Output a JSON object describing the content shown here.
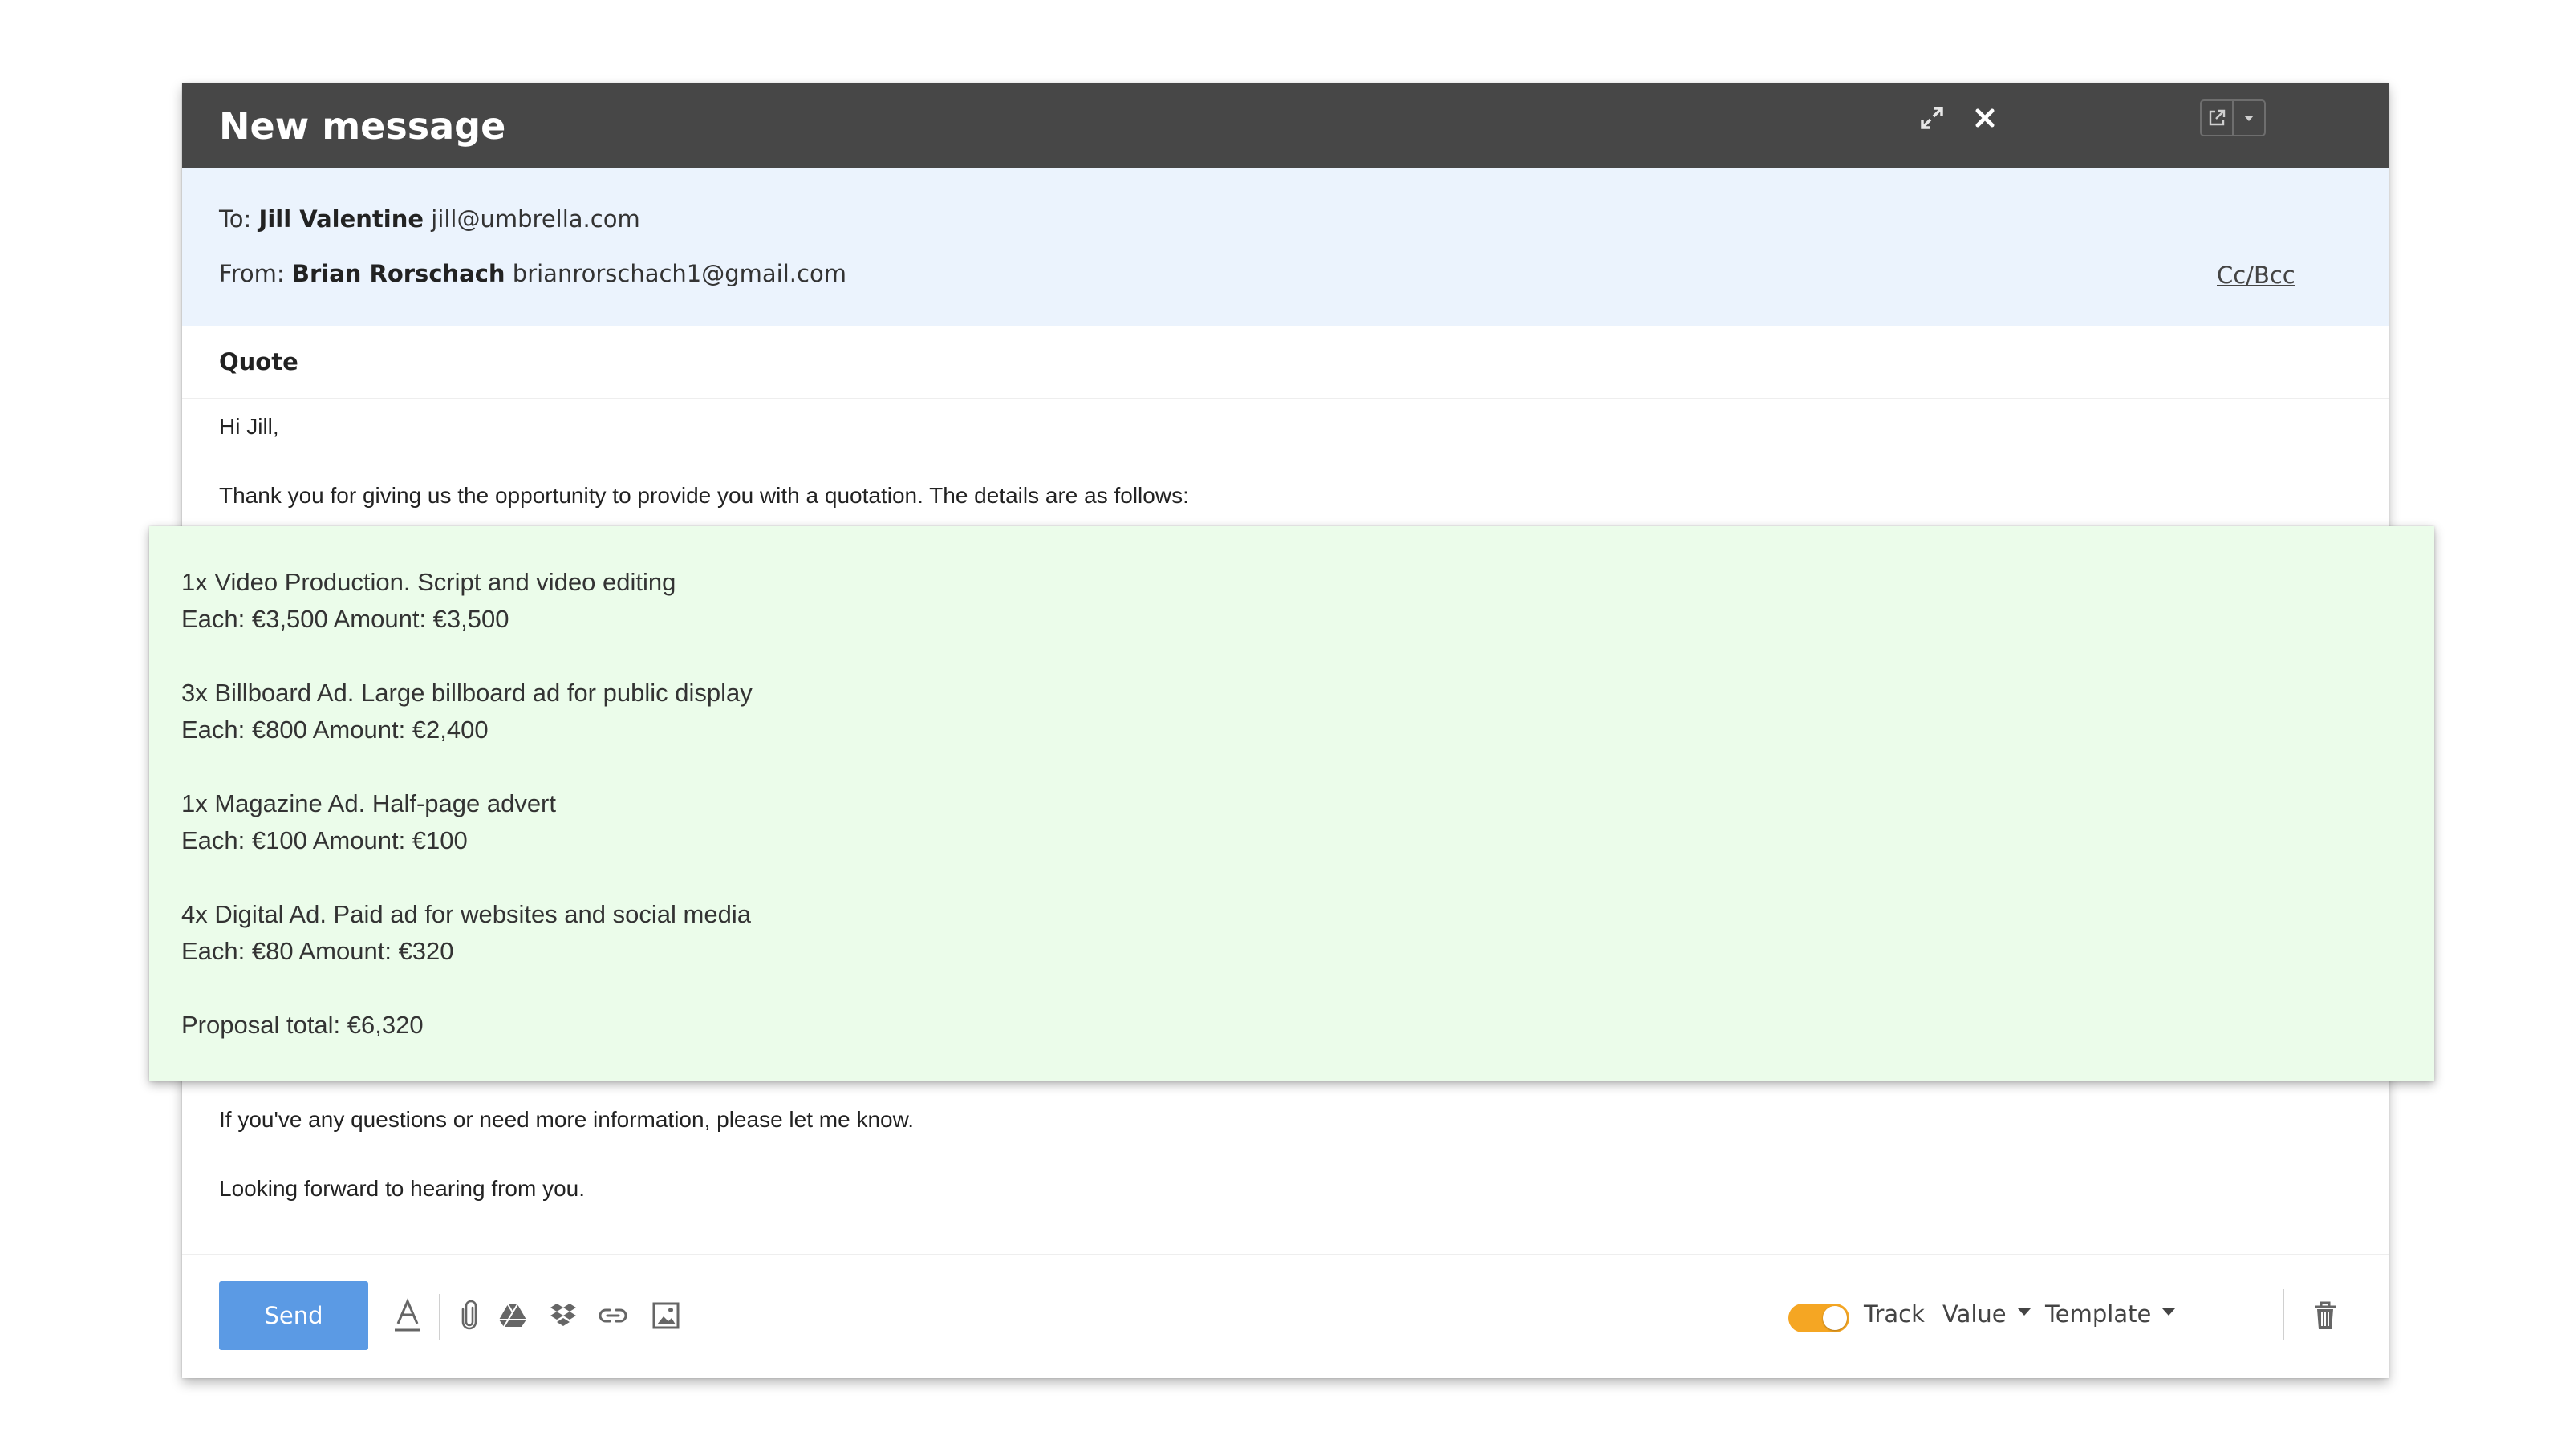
{
  "window": {
    "title": "New message"
  },
  "headers": {
    "to_label": "To:",
    "to_name": "Jill Valentine",
    "to_email": "jill@umbrella.com",
    "from_label": "From:",
    "from_name": "Brian Rorschach",
    "from_email": "brianrorschach1@gmail.com",
    "ccbcc": "Cc/Bcc"
  },
  "subject": "Quote",
  "body": {
    "greeting": "Hi Jill,",
    "intro": "Thank you for giving us the opportunity to provide you with a quotation. The details are as follows:",
    "closing1": "If you've any questions or need more information, please let me know.",
    "closing2": "Looking forward to hearing from you."
  },
  "quote": {
    "items": [
      {
        "title": "1x Video Production. Script and video editing",
        "price": "Each: €3,500  Amount: €3,500"
      },
      {
        "title": "3x Billboard Ad. Large billboard ad for public display",
        "price": "Each: €800  Amount: €2,400"
      },
      {
        "title": "1x Magazine Ad. Half-page advert",
        "price": "Each: €100  Amount: €100"
      },
      {
        "title": "4x Digital Ad. Paid ad for websites and social media",
        "price": "Each: €80  Amount: €320"
      }
    ],
    "total": "Proposal total: €6,320"
  },
  "toolbar": {
    "send_label": "Send",
    "track_label": "Track",
    "track_on": true,
    "value_label": "Value",
    "template_label": "Template",
    "icons": [
      "text-format-icon",
      "attachment-icon",
      "drive-icon",
      "dropbox-icon",
      "link-icon",
      "image-icon",
      "trash-icon"
    ]
  },
  "colors": {
    "titlebar": "#474747",
    "header_bg": "#ebf3fd",
    "quote_bg": "#ebfcea",
    "send": "#4a90e2",
    "toggle": "#f5a623"
  }
}
